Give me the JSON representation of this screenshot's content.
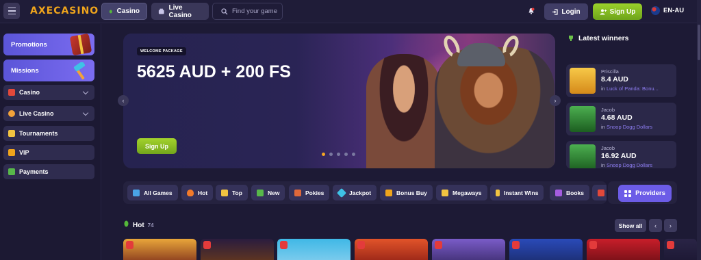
{
  "header": {
    "logo": "AXECASINO",
    "tabs": [
      {
        "label": "Casino"
      },
      {
        "label": "Live Casino"
      }
    ],
    "search_placeholder": "Find your game",
    "login_label": "Login",
    "signup_label": "Sign Up",
    "language": "EN-AU"
  },
  "sidebar": {
    "banners": [
      {
        "label": "Promotions"
      },
      {
        "label": "Missions"
      }
    ],
    "items": [
      {
        "label": "Casino"
      },
      {
        "label": "Live Casino"
      },
      {
        "label": "Tournaments"
      },
      {
        "label": "VIP"
      },
      {
        "label": "Payments"
      }
    ]
  },
  "hero": {
    "badge": "WELCOME PACKAGE",
    "title": "5625 AUD + 200 FS",
    "button": "Sign Up",
    "slide_count": 5,
    "active_slide": 1
  },
  "winners": {
    "title": "Latest winners",
    "items": [
      {
        "name": "Priscilla",
        "amount": "8.4 AUD",
        "in": "in",
        "game": "Luck of Panda: Bonu..."
      },
      {
        "name": "Jacob",
        "amount": "4.68 AUD",
        "in": "in",
        "game": "Snoop Dogg Dollars"
      },
      {
        "name": "Jacob",
        "amount": "16.92 AUD",
        "in": "in",
        "game": "Snoop Dogg Dollars"
      }
    ]
  },
  "categories": [
    {
      "label": "All Games"
    },
    {
      "label": "Hot"
    },
    {
      "label": "Top"
    },
    {
      "label": "New"
    },
    {
      "label": "Pokies"
    },
    {
      "label": "Jackpot"
    },
    {
      "label": "Bonus Buy"
    },
    {
      "label": "Megaways"
    },
    {
      "label": "Instant Wins"
    },
    {
      "label": "Books"
    }
  ],
  "providers_label": "Providers",
  "hot_section": {
    "title": "Hot",
    "count": "74",
    "show_all": "Show all"
  },
  "colors": {
    "accent": "#6c5ce7",
    "signup_green": "#8bc424",
    "background": "#1d1a35",
    "dot_active": "#f5a623"
  }
}
